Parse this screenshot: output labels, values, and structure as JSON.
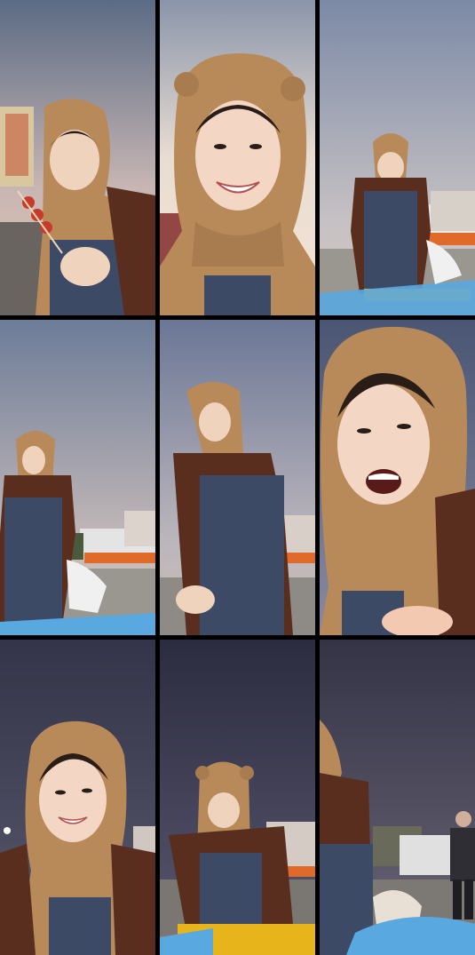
{
  "grid": {
    "rows": 3,
    "columns": 3,
    "frame_count": 9
  },
  "colors": {
    "background": "#000000",
    "hood": "#b88a5a",
    "sweater": "#5a2e1e",
    "overalls": "#3c4a66",
    "sky_dusk": "#c9b8b0",
    "sky_night": "#2e2a3c",
    "crate_yellow": "#e8b41c",
    "bag_blue": "#5aa8e0"
  }
}
